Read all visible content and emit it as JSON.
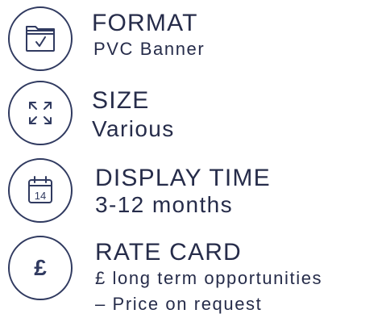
{
  "items": [
    {
      "icon": "folder-check-icon",
      "title": "FORMAT",
      "subtitle": "PVC Banner"
    },
    {
      "icon": "expand-arrows-icon",
      "title": "SIZE",
      "subtitle": "Various"
    },
    {
      "icon": "calendar-icon",
      "calendar_day": "14",
      "title": "DISPLAY TIME",
      "subtitle": "3-12 months"
    },
    {
      "icon": "pound-icon",
      "icon_glyph": "£",
      "title": "RATE CARD",
      "subtitle": "£ long term opportunities",
      "subtitle2": "– Price on request"
    }
  ],
  "colors": {
    "text": "#262c4a",
    "icon": "#303a60"
  }
}
